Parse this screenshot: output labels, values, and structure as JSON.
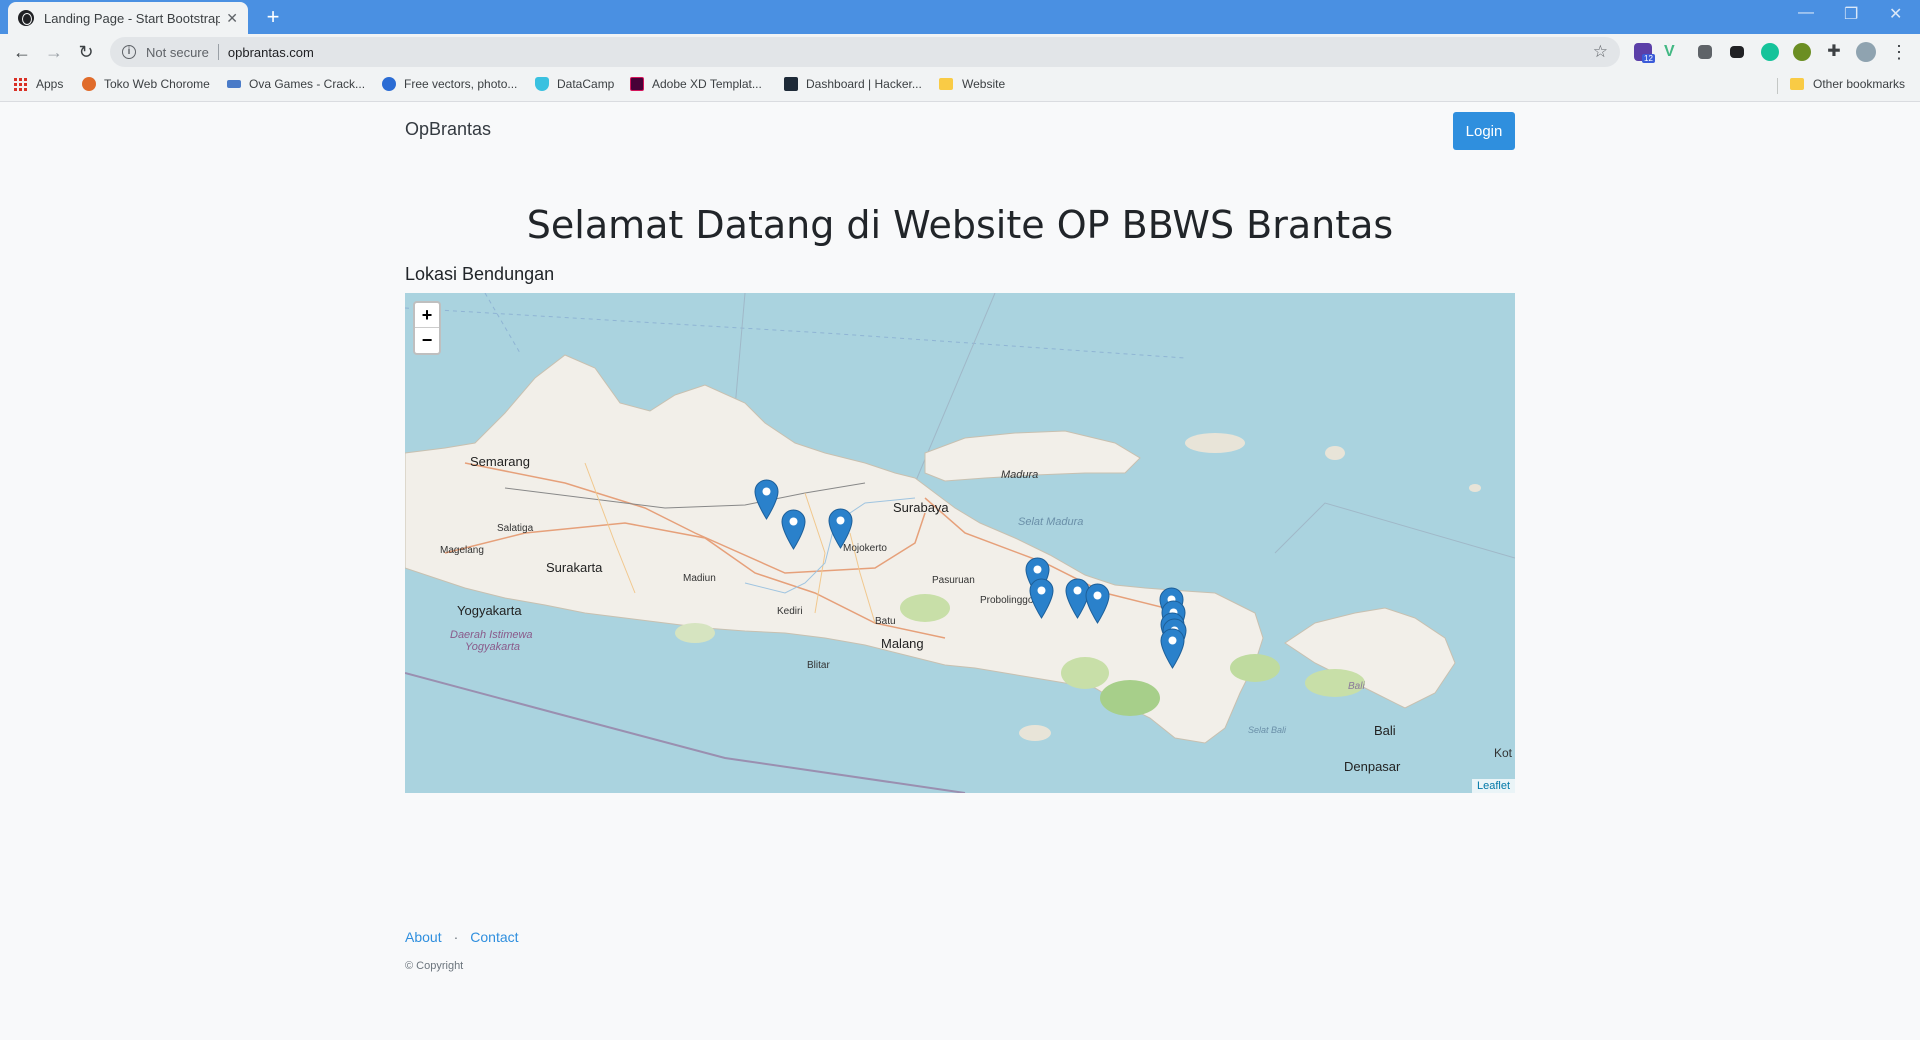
{
  "browser": {
    "tab_title": "Landing Page - Start Bootstrap T",
    "security_label": "Not secure",
    "url": "opbrantas.com",
    "extension_badge": "12",
    "bookmarks": [
      {
        "label": "Apps",
        "color": "#d93025"
      },
      {
        "label": "Toko Web Chorome",
        "color": "#e06b2a"
      },
      {
        "label": "Ova Games - Crack...",
        "color": "#4a7bc8"
      },
      {
        "label": "Free vectors, photo...",
        "color": "#2b6cd4"
      },
      {
        "label": "DataCamp",
        "color": "#3ac1e0"
      },
      {
        "label": "Adobe XD Templat...",
        "color": "#d4145a"
      },
      {
        "label": "Dashboard | Hacker...",
        "color": "#1e2a38"
      },
      {
        "label": "Website",
        "color": "#f9cb45"
      }
    ],
    "other_bookmarks": "Other bookmarks"
  },
  "navbar": {
    "brand": "OpBrantas",
    "login_label": "Login"
  },
  "hero": {
    "title": "Selamat Datang di Website OP BBWS Brantas"
  },
  "map_section": {
    "heading": "Lokasi Bendungan",
    "zoom_in": "+",
    "zoom_out": "−",
    "attribution": "Leaflet",
    "labels": {
      "semarang": "Semarang",
      "salatiga": "Salatiga",
      "magelang": "Magelang",
      "surakarta": "Surakarta",
      "yogyakarta": "Yogyakarta",
      "diy_1": "Daerah Istimewa",
      "diy_2": "Yogyakarta",
      "madiun": "Madiun",
      "kediri": "Kediri",
      "blitar": "Blitar",
      "mojokerto": "Mojokerto",
      "batu": "Batu",
      "malang": "Malang",
      "surabaya": "Surabaya",
      "pasuruan": "Pasuruan",
      "probolinggo": "Probolinggo",
      "madura": "Madura",
      "selat_madura": "Selat Madura",
      "bali_italic": "Bali",
      "bali": "Bali",
      "selat_bali": "Selat Bali",
      "denpasar": "Denpasar",
      "kot": "Kot"
    },
    "marker_color": "#2a81cb",
    "marker_count": 12
  },
  "footer": {
    "about": "About",
    "separator": "·",
    "contact": "Contact",
    "copyright": "© Copyright"
  }
}
